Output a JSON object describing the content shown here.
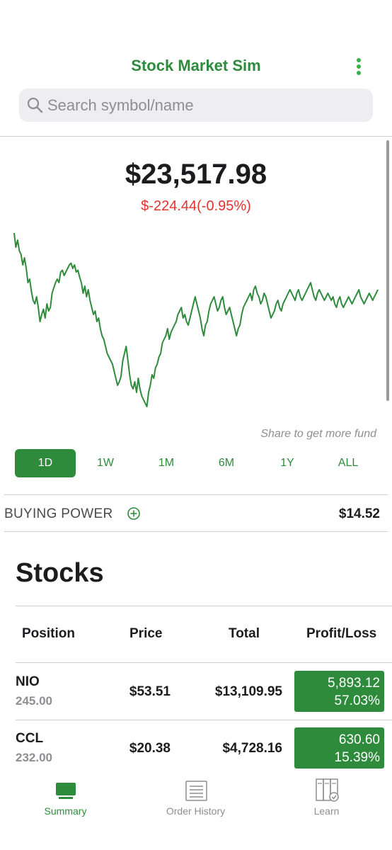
{
  "header": {
    "title": "Stock Market Sim"
  },
  "search": {
    "placeholder": "Search symbol/name",
    "value": ""
  },
  "portfolio": {
    "balance": "$23,517.98",
    "change": "$-224.44(-0.95%)"
  },
  "chart_data": {
    "type": "line",
    "title": "",
    "xlabel": "",
    "ylabel": "",
    "color": "#2e8b3c",
    "grid": false,
    "ylim": [
      0,
      100
    ],
    "values": [
      98,
      90,
      94,
      88,
      86,
      80,
      84,
      78,
      70,
      72,
      65,
      60,
      58,
      62,
      56,
      48,
      52,
      55,
      50,
      58,
      54,
      56,
      64,
      67,
      70,
      72,
      70,
      76,
      77,
      74,
      76,
      78,
      80,
      81,
      78,
      80,
      76,
      77,
      73,
      70,
      64,
      68,
      62,
      66,
      60,
      56,
      52,
      54,
      48,
      50,
      44,
      40,
      38,
      34,
      30,
      28,
      26,
      24,
      20,
      16,
      12,
      14,
      17,
      26,
      30,
      34,
      26,
      18,
      12,
      10,
      14,
      8,
      16,
      10,
      6,
      4,
      2,
      0,
      8,
      12,
      18,
      16,
      22,
      24,
      28,
      30,
      36,
      38,
      40,
      44,
      38,
      42,
      44,
      46,
      48,
      52,
      54,
      56,
      50,
      52,
      48,
      46,
      50,
      54,
      58,
      62,
      58,
      54,
      50,
      44,
      40,
      46,
      48,
      54,
      58,
      60,
      62,
      58,
      54,
      56,
      60,
      62,
      56,
      52,
      54,
      56,
      52,
      48,
      44,
      40,
      44,
      46,
      52,
      56,
      58,
      60,
      62,
      64,
      60,
      66,
      68,
      64,
      62,
      58,
      60,
      64,
      62,
      58,
      54,
      50,
      52,
      54,
      58,
      60,
      56,
      54,
      58,
      60,
      62,
      64,
      66,
      64,
      62,
      60,
      64,
      66,
      62,
      60,
      62,
      64,
      66,
      68,
      70,
      66,
      62,
      60,
      64,
      66,
      64,
      62,
      60,
      62,
      64,
      62,
      60,
      62,
      58,
      56,
      60,
      62,
      58,
      56,
      58,
      60,
      62,
      60,
      58,
      60,
      62,
      64,
      66,
      62,
      60,
      58,
      60,
      62,
      64,
      62,
      60,
      62,
      64,
      66
    ]
  },
  "share_note": "Share to get more fund",
  "ranges": {
    "active": "1D",
    "items": [
      "1D",
      "1W",
      "1M",
      "6M",
      "1Y",
      "ALL"
    ]
  },
  "buying_power": {
    "label": "BUYING POWER",
    "value": "$14.52"
  },
  "stocks": {
    "title": "Stocks",
    "headers": {
      "position": "Position",
      "price": "Price",
      "total": "Total",
      "profit_loss": "Profit/Loss"
    },
    "rows": [
      {
        "symbol": "NIO",
        "quantity": "245.00",
        "price": "$53.51",
        "total": "$13,109.95",
        "pl_amount": "5,893.12",
        "pl_percent": "57.03%"
      },
      {
        "symbol": "CCL",
        "quantity": "232.00",
        "price": "$20.38",
        "total": "$4,728.16",
        "pl_amount": "630.60",
        "pl_percent": "15.39%"
      }
    ]
  },
  "tabs": [
    {
      "label": "Summary",
      "icon": "monitor-icon",
      "active": true
    },
    {
      "label": "Order History",
      "icon": "document-list-icon",
      "active": false
    },
    {
      "label": "Learn",
      "icon": "books-check-icon",
      "active": false
    }
  ],
  "colors": {
    "accent": "#2e8b3c",
    "negative": "#e0342e"
  }
}
